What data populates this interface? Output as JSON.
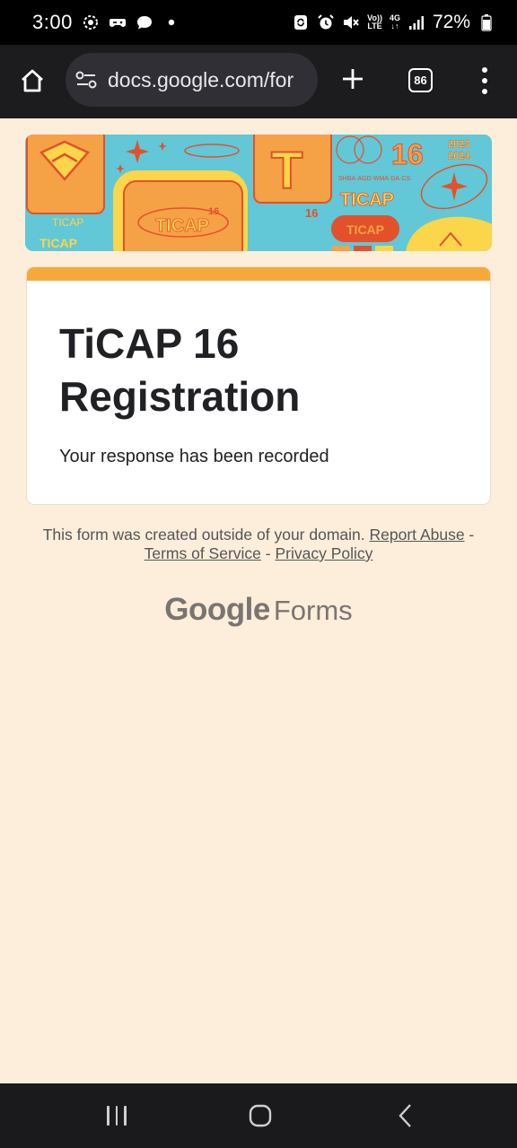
{
  "status_bar": {
    "time": "3:00",
    "battery": "72%",
    "volte_top": "Vo))",
    "volte_bottom": "LTE",
    "net_top": "4G",
    "net_bottom": "↓↑"
  },
  "browser": {
    "url": "docs.google.com/for",
    "tab_count": "86"
  },
  "banner": {
    "ticap_a": "TICAP",
    "ticap_b": "TICAP",
    "ticap_c": "TICAP",
    "ticap_d": "TICAP",
    "ticap_e": "TICAP",
    "number_a": "16",
    "number_b": "16",
    "number_c": "16",
    "letter_t": "T",
    "years_a": "2023",
    "years_b": "2024",
    "tracks": "SHBA·AGD·WMA·DA·CS"
  },
  "form": {
    "title": "TiCAP 16 Registration",
    "confirmation": "Your response has been recorded"
  },
  "footer": {
    "notice": "This form was created outside of your domain.",
    "report_abuse": "Report Abuse",
    "sep1": " - ",
    "terms": "Terms of Service",
    "sep2": " - ",
    "privacy": "Privacy Policy",
    "brand_google": "Google",
    "brand_forms": "Forms"
  },
  "colors": {
    "page_bg": "#fdeedb",
    "accent": "#f6a93b",
    "banner_teal": "#62c7d6",
    "banner_orange": "#f5a146",
    "banner_red": "#e3512b",
    "banner_yellow": "#fbd64a"
  }
}
